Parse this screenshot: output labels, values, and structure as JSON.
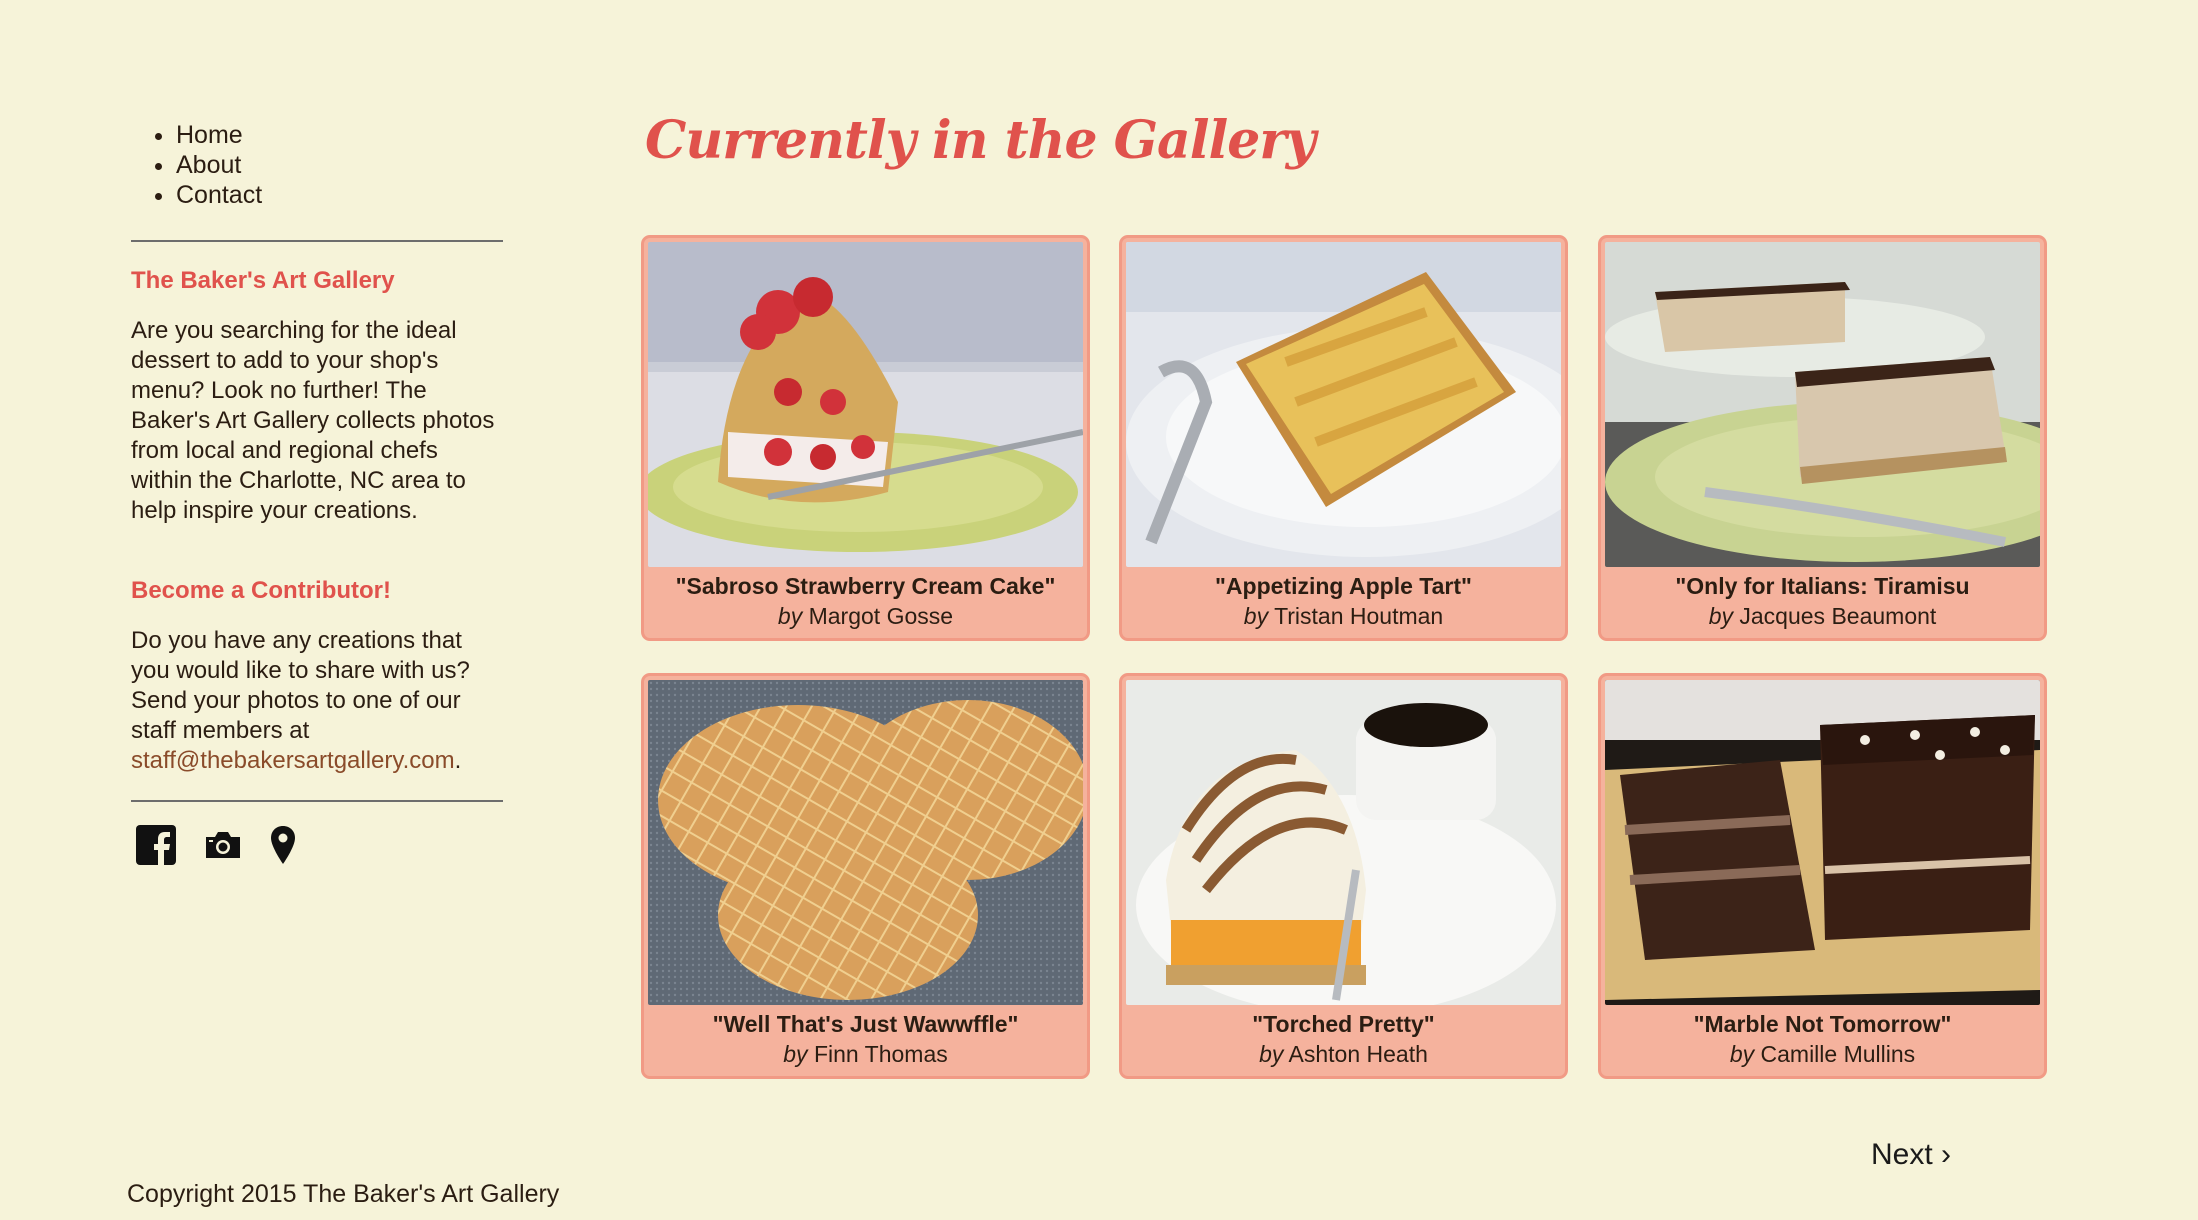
{
  "nav": {
    "items": [
      {
        "label": "Home"
      },
      {
        "label": "About"
      },
      {
        "label": "Contact"
      }
    ]
  },
  "sidebar": {
    "gallery_heading": "The Baker's Art Gallery",
    "gallery_text": "Are you searching for the ideal dessert to add to your shop's menu? Look no further! The Baker's Art Gallery collects photos from local and regional chefs within the Charlotte, NC area to help inspire your creations.",
    "contributor_heading": "Become a Contributor!",
    "contributor_text": "Do you have any creations that you would like to share with us? Send your photos to one of our staff members at",
    "email": "staff@thebakersartgallery.com",
    "email_suffix": ".",
    "social_icons": [
      "facebook-icon",
      "camera-icon",
      "map-pin-icon"
    ]
  },
  "main": {
    "title": "Currently in the Gallery",
    "by_word": "by",
    "cards": [
      {
        "title": "\"Sabroso Strawberry Cream Cake\"",
        "author": "Margot Gosse",
        "photo": "strawberry-cake"
      },
      {
        "title": "\"Appetizing Apple Tart\"",
        "author": "Tristan Houtman",
        "photo": "apple-tart"
      },
      {
        "title": "\"Only for Italians: Tiramisu",
        "author": "Jacques Beaumont",
        "photo": "tiramisu"
      },
      {
        "title": "\"Well That's Just Wawwffle\"",
        "author": "Finn Thomas",
        "photo": "waffle-cookies"
      },
      {
        "title": "\"Torched Pretty\"",
        "author": "Ashton Heath",
        "photo": "meringue-tart"
      },
      {
        "title": "\"Marble Not Tomorrow\"",
        "author": "Camille Mullins",
        "photo": "chocolate-cake"
      }
    ],
    "next_label": "Next ›"
  },
  "footer": {
    "copyright": "Copyright 2015 The Baker's Art Gallery"
  },
  "colors": {
    "background": "#f6f3d9",
    "accent": "#e0524c",
    "card": "#f5b29d",
    "card_border": "#f19a85",
    "link": "#8a4b2a"
  }
}
